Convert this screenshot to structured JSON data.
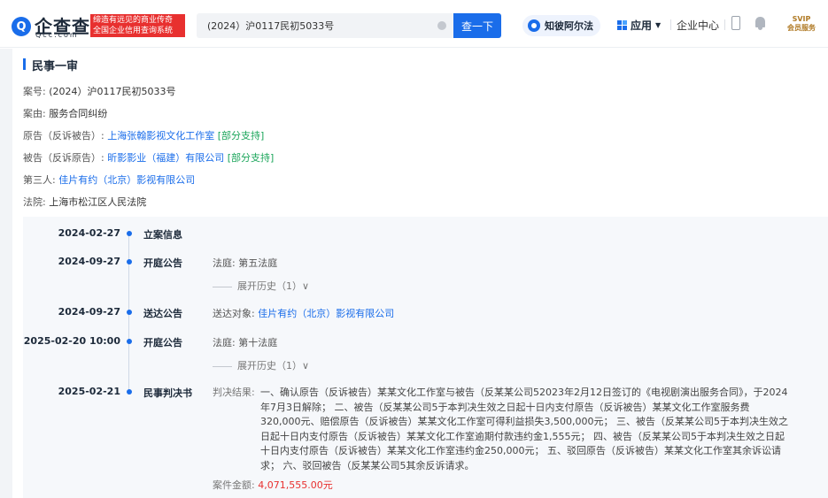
{
  "header": {
    "logo_mark": "Q",
    "logo_text": "企查查",
    "logo_sub": "Qcc.com",
    "slogan_line1": "缔造有远见的商业传奇",
    "slogan_line2": "全国企业信用查询系统",
    "search_value": "(2024）沪0117民初5033号",
    "search_button": "查一下",
    "zhibi_label": "知彼阿尔法",
    "apps_label": "应用",
    "center_label": "企业中心",
    "svip_line1": "SVIP",
    "svip_line2": "会员服务"
  },
  "case": {
    "section_title": "民事一审",
    "case_no_label": "案号:",
    "case_no": "(2024）沪0117民初5033号",
    "cause_label": "案由:",
    "cause": "服务合同纠纷",
    "plaintiff_label": "原告（反诉被告）:",
    "plaintiff": "上海张翰影视文化工作室",
    "plaintiff_result": "[部分支持]",
    "defendant_label": "被告（反诉原告）:",
    "defendant": "昕影影业（福建）有限公司",
    "defendant_result": "[部分支持]",
    "third_label": "第三人:",
    "third": "佳片有约（北京）影视有限公司",
    "court_label": "法院:",
    "court": "上海市松江区人民法院"
  },
  "timeline": [
    {
      "date": "2024-02-27",
      "title": "立案信息"
    },
    {
      "date": "2024-09-27",
      "title": "开庭公告",
      "detail_label": "法庭:",
      "detail": "第五法庭",
      "expand": "展开历史（1）∨"
    },
    {
      "date": "2024-09-27",
      "title": "送达公告",
      "detail_label": "送达对象:",
      "detail": "佳片有约（北京）影视有限公司"
    },
    {
      "date": "2025-02-20 10:00",
      "title": "开庭公告",
      "detail_label": "法庭:",
      "detail": "第十法庭",
      "expand": "展开历史（1）∨"
    },
    {
      "date": "2025-02-21",
      "title": "民事判决书",
      "detail_label": "判决结果:",
      "detail": "一、确认原告（反诉被告）某某文化工作室与被告（反某某公司52023年2月12日签订的《电视剧演出服务合同》，于2024年7月3日解除； 二、被告（反某某公司5于本判决生效之日起十日内支付原告（反诉被告）某某文化工作室服务费320,000元、赔偿原告（反诉被告）某某文化工作室可得利益损失3,500,000元； 三、被告（反某某公司5于本判决生效之日起十日内支付原告（反诉被告）某某文化工作室逾期付款违约金1,555元； 四、被告（反某某公司5于本判决生效之日起十日内支付原告（反诉被告）某某文化工作室违约金250,000元； 五、驳回原告（反诉被告）某某文化工作室其余诉讼请求； 六、驳回被告（反某某公司5其余反诉请求。",
      "amount_label": "案件金额:",
      "amount": "4,071,555.00元"
    }
  ],
  "colors": {
    "brand": "#1a6dea",
    "slogan_bg": "#e8302f",
    "support": "#1aa55a",
    "amount": "#e8302f"
  }
}
